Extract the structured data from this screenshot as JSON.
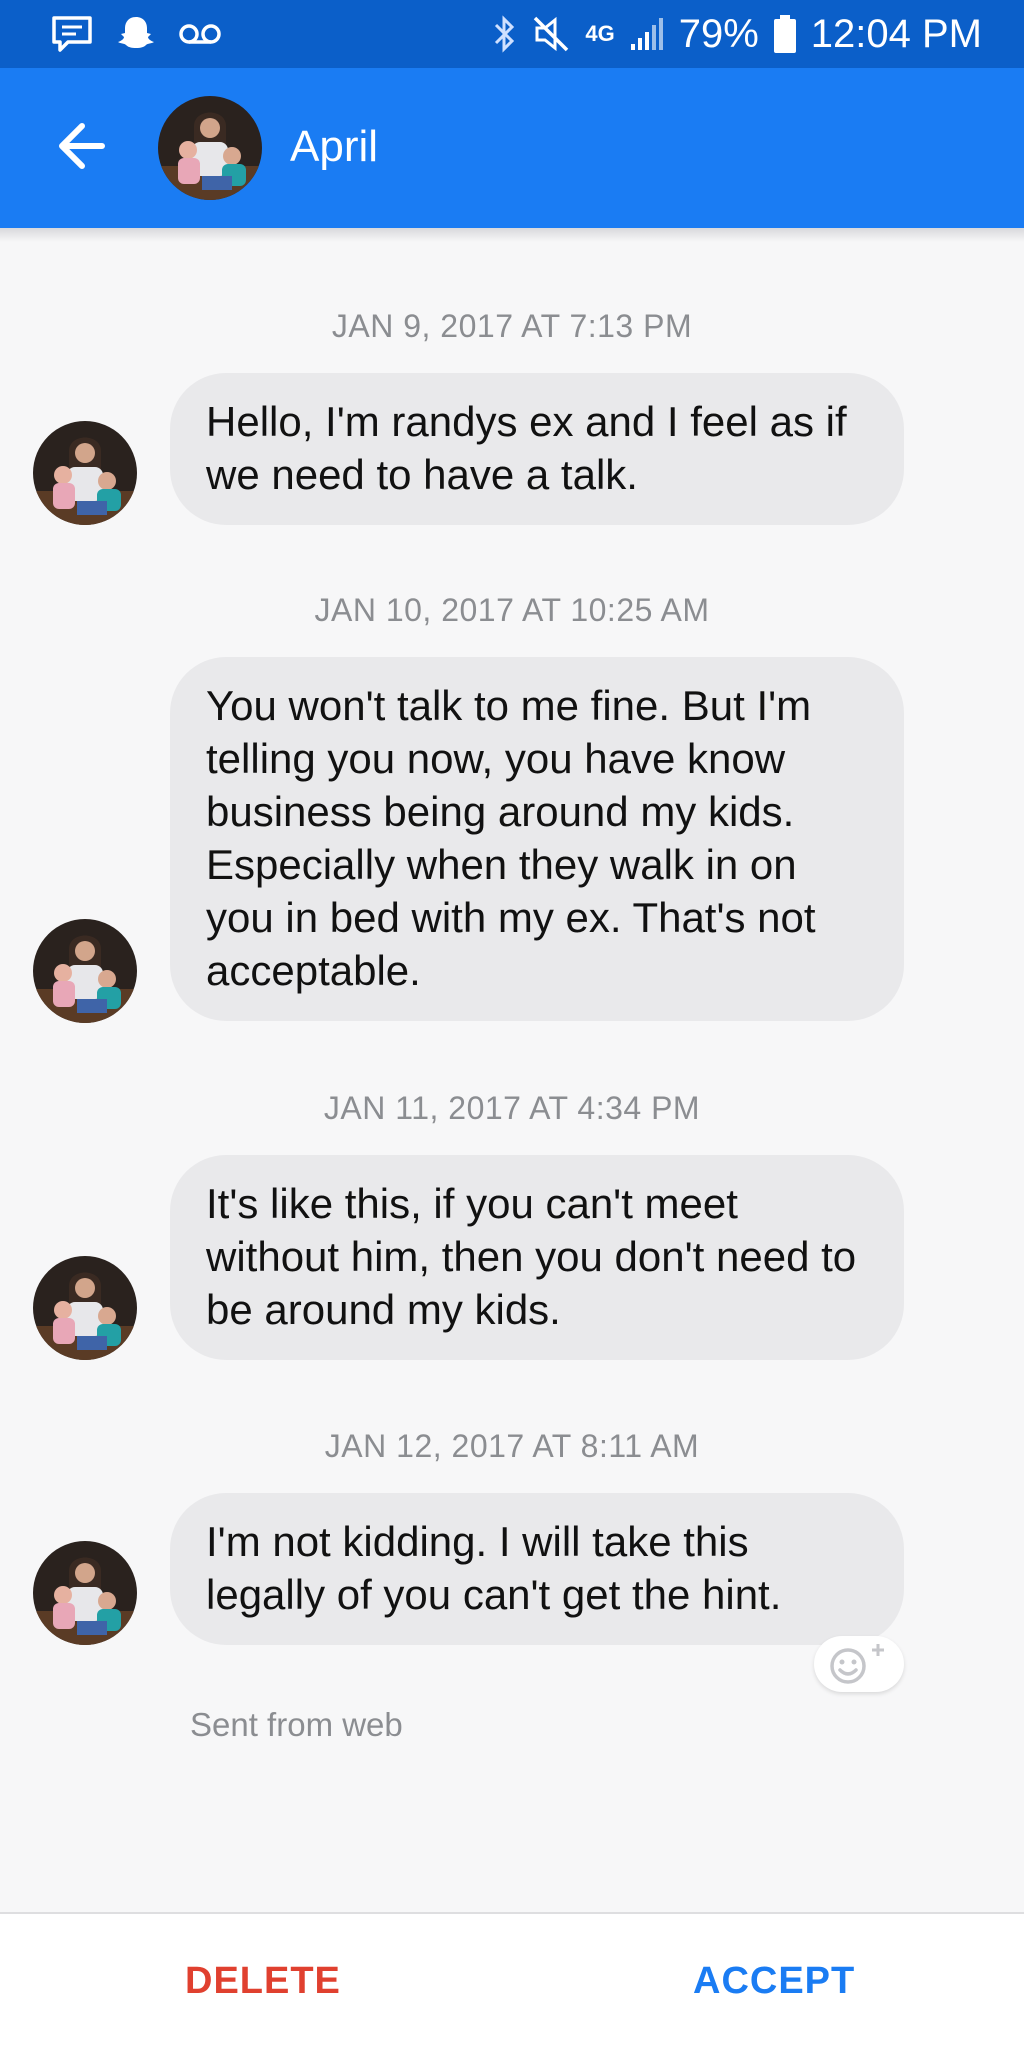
{
  "status_bar": {
    "network": "4G",
    "battery": "79%",
    "time": "12:04 PM",
    "icons": [
      "messages-icon",
      "snapchat-icon",
      "voicemail-icon",
      "bluetooth-icon",
      "mute-icon",
      "signal-icon",
      "battery-icon"
    ]
  },
  "header": {
    "contact_name": "April"
  },
  "conversation": {
    "messages": [
      {
        "timestamp": "JAN 9, 2017 AT 7:13 PM",
        "text": "Hello, I'm randys ex and I feel as if we need to have a talk."
      },
      {
        "timestamp": "JAN 10, 2017 AT 10:25 AM",
        "text": "You won't talk to me fine. But I'm telling you now, you have know business being around my kids. Especially when they walk in on you in bed with my ex. That's not acceptable."
      },
      {
        "timestamp": "JAN 11, 2017 AT 4:34 PM",
        "text": "It's like this, if you can't meet without him, then you don't need to be around my kids."
      },
      {
        "timestamp": "JAN 12, 2017 AT 8:11 AM",
        "text": "I'm not kidding. I will take this legally of you can't get the hint."
      }
    ],
    "sent_from": "Sent from web"
  },
  "footer": {
    "delete_label": "DELETE",
    "accept_label": "ACCEPT"
  },
  "colors": {
    "status_bar": "#0b5fc9",
    "header": "#1a7cf3",
    "bubble": "#e9e9eb",
    "delete": "#e0402f",
    "accept": "#1a7cf3"
  }
}
